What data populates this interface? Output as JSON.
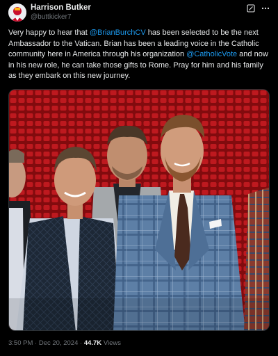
{
  "author": {
    "display_name": "Harrison Butker",
    "handle": "@buttkicker7"
  },
  "post": {
    "text_1": "Very happy to hear that ",
    "mention_1": "@BrianBurchCV",
    "text_2": " has been selected to be the next Ambassador to the Vatican. Brian has been a leading voice in the Catholic community here in America through his organization ",
    "mention_2": "@CatholicVote",
    "text_3": " and now in his new role, he can take those gifts to Rome. Pray for him and his family as they embark on this new journey."
  },
  "meta": {
    "time": "3:50 PM",
    "separator": "·",
    "date": "Dec 20, 2024",
    "separator_2": "·",
    "views_count": "44.7K",
    "views_label": "Views"
  },
  "icons": {
    "grok": "grok-icon",
    "more": "more-options-icon"
  },
  "colors": {
    "background": "#000000",
    "text": "#e7e9ea",
    "secondary": "#71767b",
    "link": "#1d9bf0",
    "stadium_red": "#b5161a"
  }
}
